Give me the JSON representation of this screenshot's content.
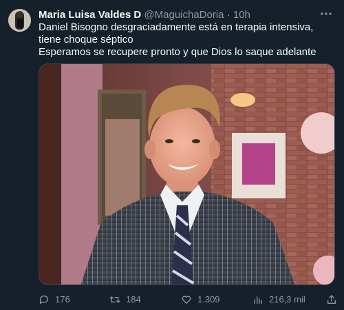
{
  "tweet": {
    "author_name": "Maria Luisa Valdes D",
    "author_handle": "@MaguichaDoria",
    "separator": "·",
    "time": "10h",
    "text_line1": "Daniel Bisogno desgraciadamente está en terapia intensiva, tiene choque séptico",
    "text_line2": "Esperamos se recupere pronto y que Dios lo saque adelante"
  },
  "icons": {
    "more": "more-horizontal-icon",
    "reply": "reply-icon",
    "retweet": "retweet-icon",
    "like": "heart-icon",
    "views": "views-icon",
    "share": "share-icon"
  },
  "actions": {
    "replies": "176",
    "retweets": "184",
    "likes": "1.309",
    "views": "216,3 mil"
  },
  "colors": {
    "background": "#15202b",
    "text_primary": "#f7f9f9",
    "text_secondary": "#8b98a5",
    "border": "#38444d"
  }
}
